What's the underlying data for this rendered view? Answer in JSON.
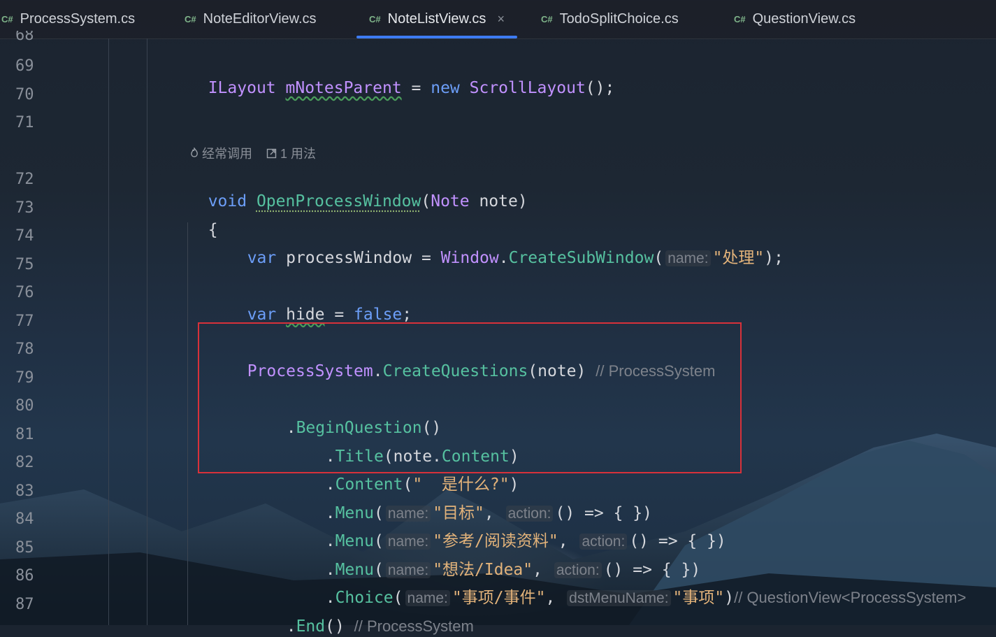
{
  "tabs": [
    {
      "lang": "C#",
      "label": "ProcessSystem.cs"
    },
    {
      "lang": "C#",
      "label": "NoteEditorView.cs"
    },
    {
      "lang": "C#",
      "label": "NoteListView.cs",
      "active": true,
      "close": "×"
    },
    {
      "lang": "C#",
      "label": "TodoSplitChoice.cs"
    },
    {
      "lang": "C#",
      "label": "QuestionView.cs"
    }
  ],
  "line_numbers": [
    "68",
    "69",
    "70",
    "71",
    "72",
    "73",
    "74",
    "75",
    "76",
    "77",
    "78",
    "79",
    "80",
    "81",
    "82",
    "83",
    "84",
    "85",
    "86",
    "87"
  ],
  "code_lens": {
    "frequent": "经常调用",
    "usages": "1 用法"
  },
  "code": {
    "l69": {
      "type": "ILayout",
      "field": "mNotesParent",
      "eq": " = ",
      "kw": "new",
      "ctor": "ScrollLayout",
      "tail": "();"
    },
    "l72": {
      "kw": "void",
      "method": "OpenProcessWindow",
      "open": "(",
      "type": "Note",
      "param": " note)"
    },
    "l73": {
      "brace": "{"
    },
    "l74": {
      "kw": "var",
      "name": " processWindow = ",
      "type": "Window",
      "dot": ".",
      "method": "CreateSubWindow",
      "open": "(",
      "hint": "name:",
      "str": "\"处理\"",
      "tail": ");"
    },
    "l76": {
      "kw": "var",
      "name": "hide",
      "eq": " = ",
      "val": "false",
      "tail": ";"
    },
    "l78": {
      "type": "ProcessSystem",
      "dot": ".",
      "method": "CreateQuestions",
      "args": "(note)",
      "comment": "// ProcessSystem"
    },
    "l80": {
      "dot": ".",
      "method": "BeginQuestion",
      "tail": "()"
    },
    "l81": {
      "dot": ".",
      "method": "Title",
      "open": "(note.",
      "prop": "Content",
      "tail": ")"
    },
    "l82": {
      "dot": ".",
      "method": "Content",
      "open": "(",
      "str": "\"  是什么?\"",
      "tail": ")"
    },
    "l83": {
      "dot": ".",
      "method": "Menu",
      "open": "(",
      "hint1": "name:",
      "str": "\"目标\"",
      "comma": ", ",
      "hint2": "action:",
      "tail": "() => { })"
    },
    "l84": {
      "dot": ".",
      "method": "Menu",
      "open": "(",
      "hint1": "name:",
      "str": "\"参考/阅读资料\"",
      "comma": ", ",
      "hint2": "action:",
      "tail": "() => { })"
    },
    "l85": {
      "dot": ".",
      "method": "Menu",
      "open": "(",
      "hint1": "name:",
      "str": "\"想法/Idea\"",
      "comma": ", ",
      "hint2": "action:",
      "tail": "() => { })"
    },
    "l86": {
      "dot": ".",
      "method": "Choice",
      "open": "(",
      "hint1": "name:",
      "str": "\"事项/事件\"",
      "comma": ", ",
      "hint2": "dstMenuName:",
      "str2": "\"事项\"",
      "tail": ")",
      "comment": "// QuestionView<ProcessSystem>"
    },
    "l87": {
      "dot": ".",
      "method": "End",
      "tail": "()",
      "comment": "// ProcessSystem"
    }
  },
  "colors": {
    "accent": "#3d7bf2",
    "highlight_box": "#d8313a"
  }
}
